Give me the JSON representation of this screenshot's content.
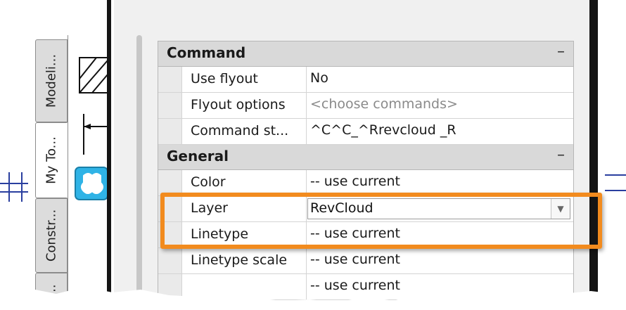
{
  "tabs": [
    {
      "label": "Modeli...",
      "active": false
    },
    {
      "label": "My To...",
      "active": true
    },
    {
      "label": "Constr...",
      "active": false
    },
    {
      "label": "...",
      "active": false
    }
  ],
  "properties": {
    "categories": [
      {
        "name": "Command",
        "toggle": "–",
        "rows": [
          {
            "name": "Use flyout",
            "value": "No"
          },
          {
            "name": "Flyout options",
            "value": "<choose commands>"
          },
          {
            "name": "Command st...",
            "value": "^C^C_^Rrevcloud _R"
          }
        ]
      },
      {
        "name": "General",
        "toggle": "–",
        "rows": [
          {
            "name": "Color",
            "value": "-- use current"
          },
          {
            "name": "Layer",
            "value": "RevCloud"
          },
          {
            "name": "Linetype",
            "value": "-- use current"
          },
          {
            "name": "Linetype scale",
            "value": "-- use current"
          },
          {
            "name": "",
            "value": "-- use current"
          }
        ]
      }
    ]
  },
  "colors": {
    "highlight": "#f28b1e",
    "accent_line": "#2a3f9f",
    "tool_icon": "#2fb3e6"
  },
  "icons": {
    "hatch": "hatch-icon",
    "dimension": "dimension-icon",
    "revcloud": "revcloud-icon",
    "dropdown": "dropdown-arrow-icon"
  }
}
